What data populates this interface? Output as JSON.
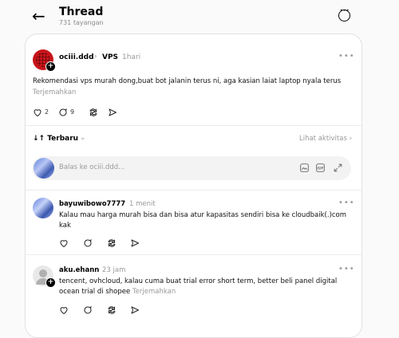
{
  "header": {
    "back_icon": "arrow-left-icon",
    "title": "Thread",
    "views": "731 tayangan",
    "more_icon": "more-circle-icon"
  },
  "post": {
    "username": "ociii.ddd",
    "separator": "›",
    "topic": "VPS",
    "time": "1hari",
    "text": "Rekomendasi vps murah dong,buat bot jalanin terus ni, aga kasian laiat laptop nyala terus",
    "translate": "Terjemahkan",
    "likes": "2",
    "comments": "9",
    "avatar_color": "#c8141b"
  },
  "sort": {
    "label": "Terbaru",
    "chevron": "⌄",
    "activity": "Lihat aktivitas ›"
  },
  "reply_box": {
    "placeholder": "Balas ke ociii.ddd..."
  },
  "replies": [
    {
      "username": "bayuwibowo7777",
      "time": "1 menit",
      "text": "Kalau mau harga murah bisa dan bisa atur kapasitas sendiri bisa ke cloudbaik(.)com kak"
    },
    {
      "username": "aku.ehann",
      "time": "23 jam",
      "text": "tencent, ovhcloud, kalau cuma buat trial error short term, better beli panel digital ocean trial di shopee",
      "translate": "Terjemahkan"
    }
  ],
  "menu_dots": "•••"
}
